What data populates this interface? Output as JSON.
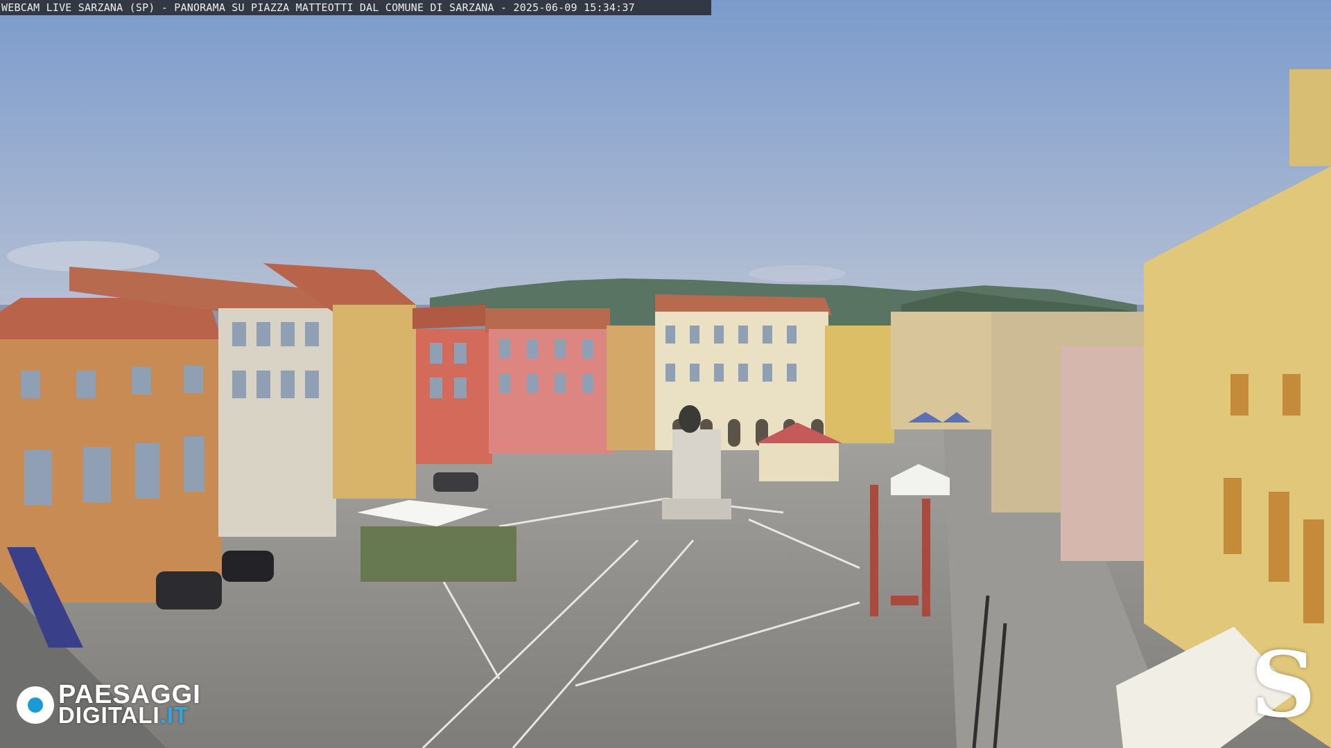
{
  "overlay": {
    "caption": "WEBCAM LIVE SARZANA (SP) - PANORAMA SU PIAZZA MATTEOTTI DAL COMUNE DI SARZANA - 2025-06-09  15:34:37",
    "logo_top": "PAESAGGI",
    "logo_bottom": "DIGITALI",
    "logo_tld": ".IT",
    "corner_glyph": "S"
  },
  "colors": {
    "sky_top": "#7d9ccb",
    "sky_bottom": "#aeb9cf",
    "hills": "#4f6a58",
    "pavement": "#8e8c89",
    "pavement_lines": "#e8e8e4",
    "roof": "#b8634a",
    "logo_accent": "#1c9ad6"
  },
  "icons": [
    "paesaggi-digitali-logo-icon",
    "sarzana-s-icon"
  ]
}
